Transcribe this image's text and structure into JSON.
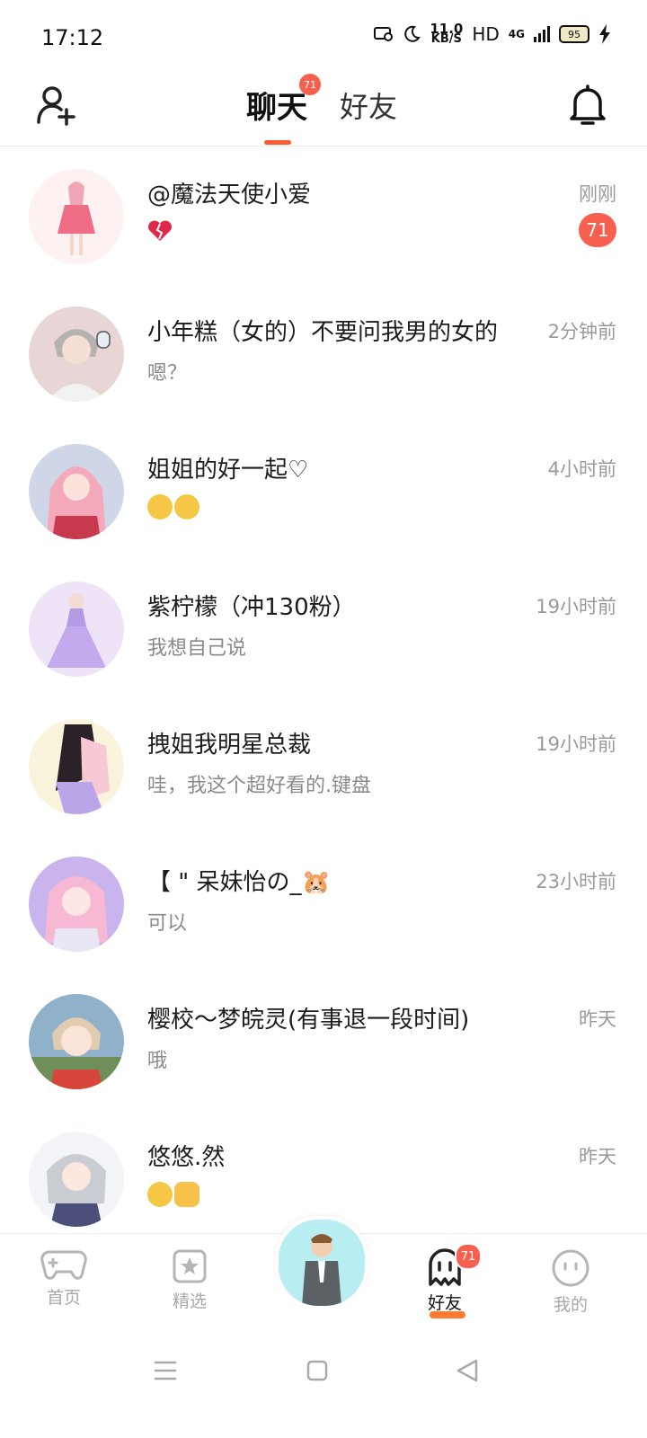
{
  "status_bar": {
    "time": "17:12",
    "speed_value": "11.0",
    "speed_unit": "KB/S",
    "hd": "HD",
    "network": "4G",
    "battery": "95"
  },
  "header": {
    "tab_chat": "聊天",
    "tab_chat_badge": "71",
    "tab_friends": "好友"
  },
  "chats": [
    {
      "name": "@魔法天使小爱",
      "preview": "",
      "time": "刚刚",
      "badge": "71"
    },
    {
      "name": "小年糕（女的）不要问我男的女的",
      "preview": "嗯？",
      "time": "2分钟前"
    },
    {
      "name": "姐姐的好一起♡",
      "preview": "",
      "time": "4小时前"
    },
    {
      "name": "紫柠檬（冲130粉）",
      "preview": "我想自己说",
      "time": "19小时前"
    },
    {
      "name": "拽姐我明星总裁",
      "preview": "哇，我这个超好看的.键盘",
      "time": "19小时前"
    },
    {
      "name": "【 \" 呆妹怡の_🐹",
      "preview": "可以",
      "time": "23小时前"
    },
    {
      "name": "樱校～梦皖灵(有事退一段时间)",
      "preview": "哦",
      "time": "昨天"
    },
    {
      "name": "悠悠.然",
      "preview": "",
      "time": "昨天"
    }
  ],
  "bottom_nav": {
    "home": "首页",
    "featured": "精选",
    "friends": "好友",
    "friends_badge": "71",
    "mine": "我的"
  },
  "colors": {
    "accent": "#ff5b2e",
    "badge": "#f7604f"
  }
}
